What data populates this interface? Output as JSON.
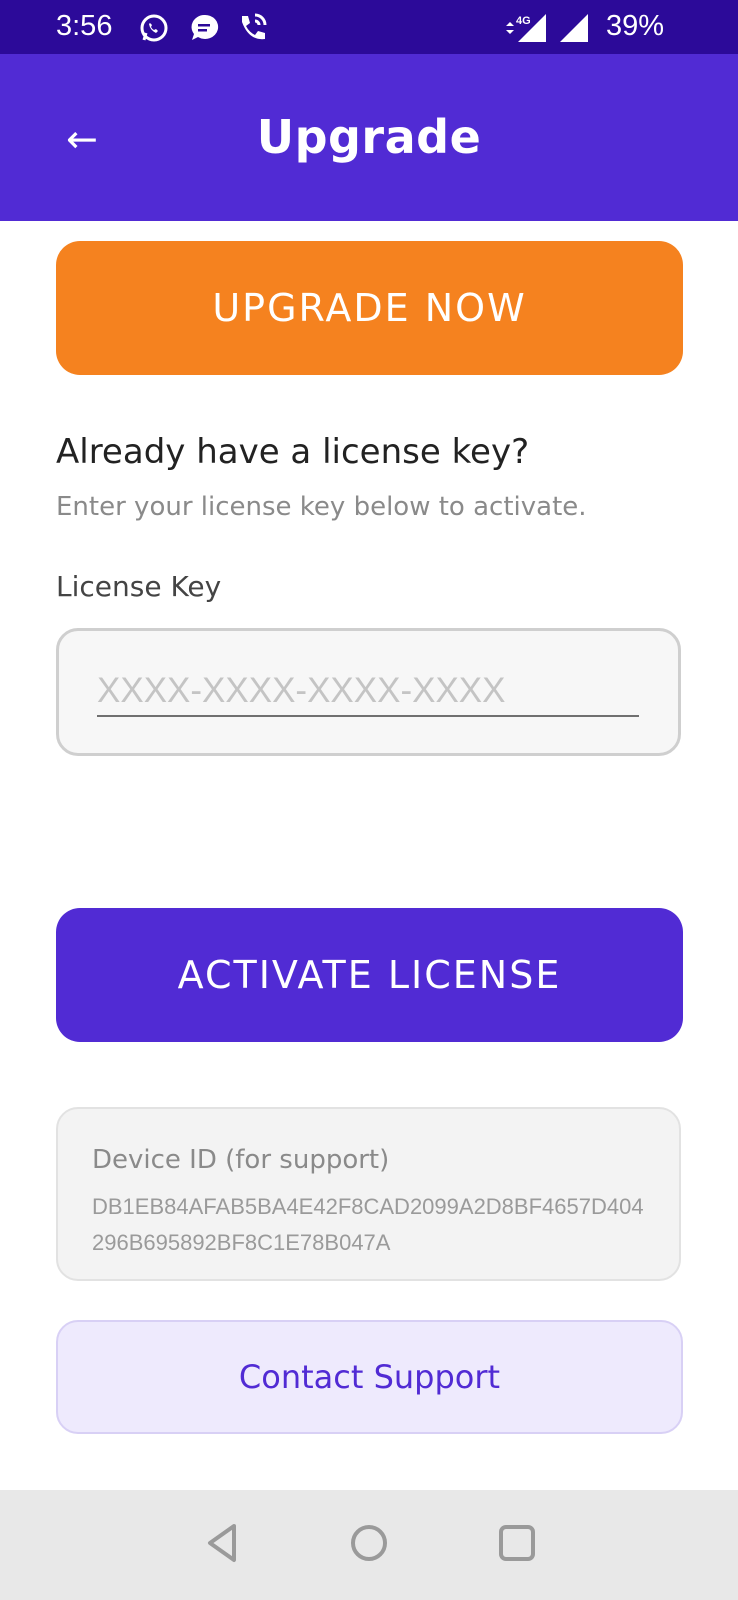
{
  "status_bar": {
    "time": "3:56",
    "battery": "39%",
    "network": "4G",
    "icons": [
      "whatsapp-icon",
      "message-icon",
      "phone-call-icon",
      "signal-4g-icon",
      "signal-icon"
    ]
  },
  "app_bar": {
    "title": "Upgrade",
    "back_icon": "←"
  },
  "upgrade_button": {
    "label": "UPGRADE NOW"
  },
  "license": {
    "heading": "Already have a license key?",
    "subheading": "Enter your license key below to activate.",
    "field_label": "License Key",
    "placeholder": "XXXX-XXXX-XXXX-XXXX",
    "value": ""
  },
  "activate_button": {
    "label": "ACTIVATE LICENSE"
  },
  "device": {
    "label": "Device ID (for support)",
    "id": "DB1EB84AFAB5BA4E42F8CAD2099A2D8BF4657D404296B695892BF8C1E78B047A"
  },
  "support_button": {
    "label": "Contact Support"
  },
  "nav_bar": {
    "icons": [
      "back-triangle-icon",
      "home-circle-icon",
      "recents-square-icon"
    ]
  },
  "colors": {
    "status_bar": "#2c0a99",
    "primary": "#512bd4",
    "accent_orange": "#f5821f",
    "support_bg": "#eeeafd"
  }
}
